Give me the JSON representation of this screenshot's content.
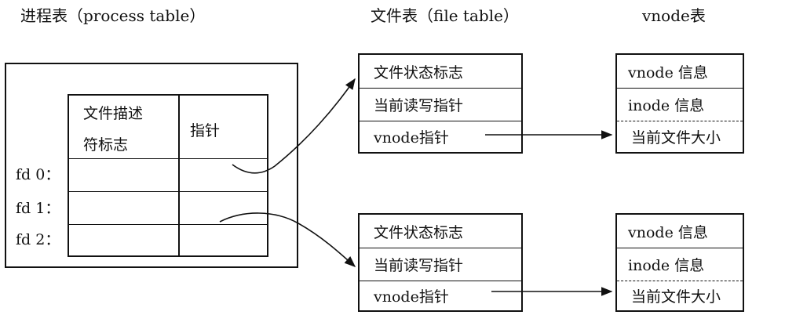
{
  "headers": {
    "process_table": "进程表（process table）",
    "file_table": "文件表（file table）",
    "vnode_table": "vnode表"
  },
  "process_table": {
    "col1_line1": "文件描述",
    "col1_line2": "符标志",
    "col2": "指针",
    "rows": [
      "fd 0：",
      "fd 1：",
      "fd 2："
    ]
  },
  "file_entries": [
    {
      "status_flags": "文件状态标志",
      "rw_pointer": "当前读写指针",
      "vnode_pointer": "vnode指针"
    },
    {
      "status_flags": "文件状态标志",
      "rw_pointer": "当前读写指针",
      "vnode_pointer": "vnode指针"
    }
  ],
  "vnode_entries": [
    {
      "vnode_info": "vnode 信息",
      "inode_info": "inode 信息",
      "file_size": "当前文件大小"
    },
    {
      "vnode_info": "vnode 信息",
      "inode_info": "inode 信息",
      "file_size": "当前文件大小"
    }
  ]
}
